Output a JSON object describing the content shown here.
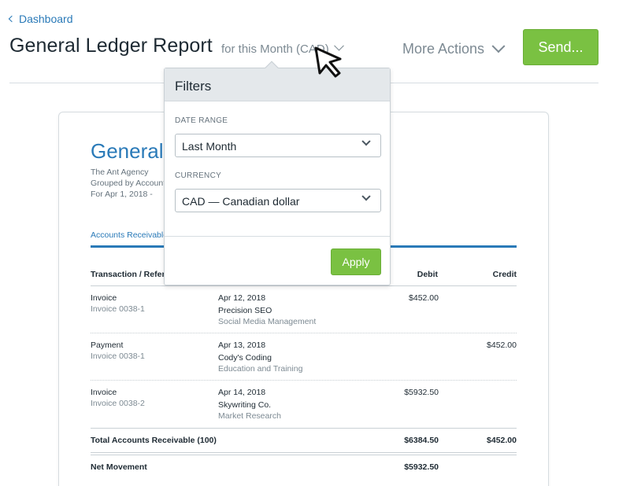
{
  "breadcrumb": {
    "label": "Dashboard"
  },
  "header": {
    "title": "General Ledger Report",
    "period_label": "for this Month (CAD)",
    "more_actions_label": "More Actions",
    "send_label": "Send..."
  },
  "report": {
    "title": "General",
    "company": "The Ant Agency",
    "grouped_by": "Grouped by Account",
    "date_range": "For Apr 1, 2018 -",
    "tab": "Accounts Receivable",
    "columns": {
      "transaction": "Transaction / Refer",
      "debit": "Debit",
      "credit": "Credit"
    },
    "rows": [
      {
        "type": "Invoice",
        "ref": "Invoice 0038-1",
        "date": "Apr 12, 2018",
        "client": "Precision SEO",
        "desc": "Social Media Management",
        "debit": "$452.00",
        "credit": ""
      },
      {
        "type": "Payment",
        "ref": "Invoice 0038-1",
        "date": "Apr 13, 2018",
        "client": "Cody's Coding",
        "desc": "Education and Training",
        "debit": "",
        "credit": "$452.00"
      },
      {
        "type": "Invoice",
        "ref": "Invoice 0038-2",
        "date": "Apr 14, 2018",
        "client": "Skywriting Co.",
        "desc": "Market Research",
        "debit": "$5932.50",
        "credit": ""
      }
    ],
    "total": {
      "label": "Total Accounts Receivable (100)",
      "debit": "$6384.50",
      "credit": "$452.00"
    },
    "net": {
      "label": "Net Movement",
      "debit": "$5932.50"
    }
  },
  "filters": {
    "title": "Filters",
    "date_range_label": "DATE RANGE",
    "date_range_value": "Last Month",
    "currency_label": "CURRENCY",
    "currency_value": "CAD — Canadian dollar",
    "apply_label": "Apply"
  },
  "colors": {
    "accent_blue": "#2a7ab8",
    "action_green": "#7ac142",
    "muted_text": "#7d8a93"
  }
}
